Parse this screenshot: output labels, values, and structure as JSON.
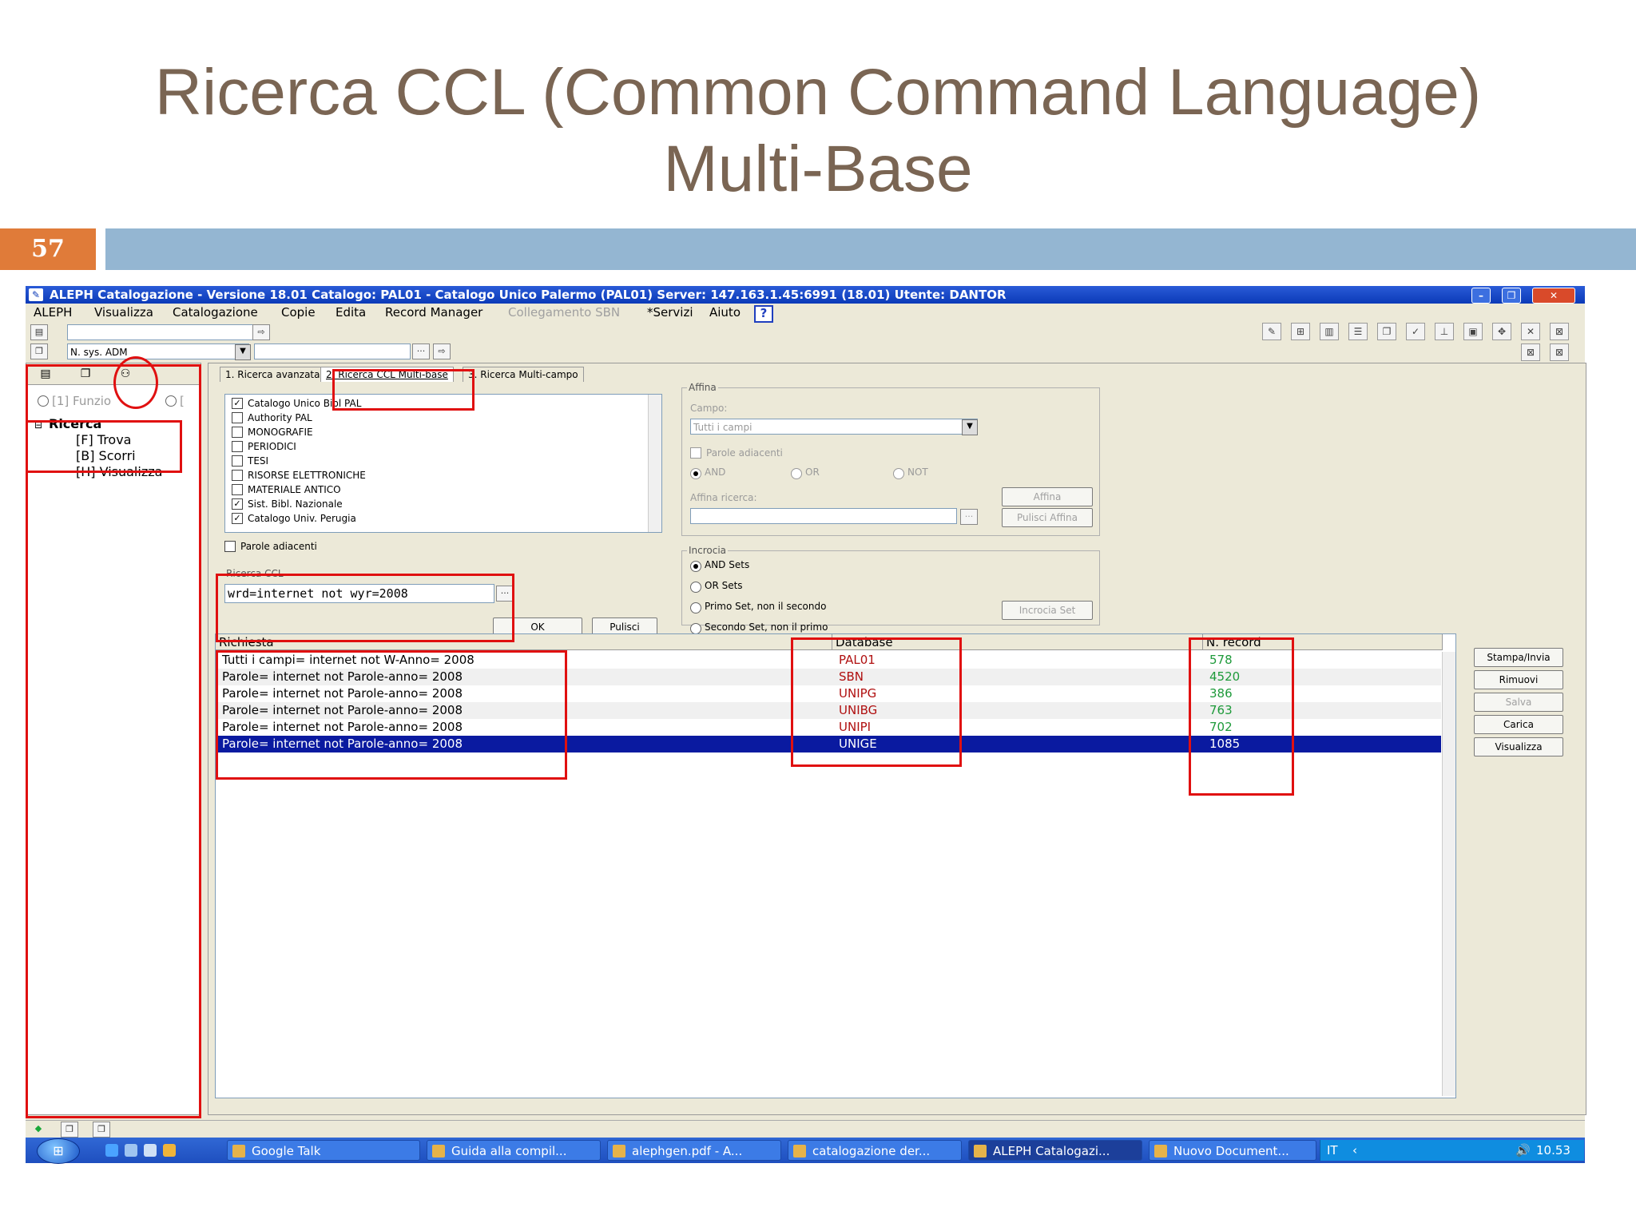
{
  "slide": {
    "title_line1": "Ricerca CCL (Common Command Language)",
    "title_line2": "Multi-Base",
    "number": "57",
    "colors": {
      "number_bg": "#e07b39",
      "bar": "#94b6d2",
      "title": "#7a6553"
    }
  },
  "window": {
    "title": "ALEPH Catalogazione - Versione 18.01  Catalogo:  PAL01 - Catalogo Unico Palermo (PAL01)  Server:  147.163.1.45:6991 (18.01)  Utente:  DANTOR",
    "controls": {
      "minimize": "–",
      "restore": "❐",
      "close": "✕"
    }
  },
  "menu": {
    "items": [
      "ALEPH",
      "Visualizza",
      "Catalogazione",
      "Copie",
      "Edita",
      "Record Manager",
      "Collegamento SBN",
      "*Servizi",
      "Aiuto"
    ],
    "help_icon": "?"
  },
  "toolbar": {
    "index_select": "N. sys. ADM",
    "browse_button": "···",
    "go_arrow": "⇨"
  },
  "left_panel": {
    "radio1": "[1] Funzio",
    "radio2": "[",
    "tree_root": "Ricerca",
    "tree_items": [
      "[F] Trova",
      "[B] Scorri",
      "[H] Visualizza"
    ],
    "tree_toggle": "⊟"
  },
  "tabs": [
    "1. Ricerca avanzata",
    "2. Ricerca CCL Multi-base",
    "3. Ricerca Multi-campo"
  ],
  "databases": [
    {
      "label": "Catalogo Unico Bibl PAL",
      "checked": true
    },
    {
      "label": "Authority PAL",
      "checked": false
    },
    {
      "label": "MONOGRAFIE",
      "checked": false
    },
    {
      "label": "PERIODICI",
      "checked": false
    },
    {
      "label": "TESI",
      "checked": false
    },
    {
      "label": "RISORSE ELETTRONICHE",
      "checked": false
    },
    {
      "label": "MATERIALE ANTICO",
      "checked": false
    },
    {
      "label": "Sist. Bibl. Nazionale",
      "checked": true
    },
    {
      "label": "Catalogo Univ. Perugia",
      "checked": true
    }
  ],
  "ccl": {
    "adjacent_label": "Parole adiacenti",
    "group_label": "Ricerca CCL",
    "query": "wrd=internet not wyr=2008",
    "browse": "···",
    "ok": "OK",
    "clear": "Pulisci"
  },
  "affina": {
    "group_label": "Affina",
    "campo_label": "Campo:",
    "campo_value": "Tutti i campi",
    "adjacent": "Parole adiacenti",
    "and": "AND",
    "or": "OR",
    "not": "NOT",
    "search_label": "Affina ricerca:",
    "browse": "···",
    "affina_btn": "Affina",
    "clear_btn": "Pulisci Affina"
  },
  "incrocia": {
    "group_label": "Incrocia",
    "options": [
      "AND Sets",
      "OR Sets",
      "Primo Set, non il secondo",
      "Secondo Set, non il primo"
    ],
    "button": "Incrocia Set"
  },
  "results": {
    "headers": {
      "query": "Richiesta",
      "database": "Database",
      "records": "N. record"
    },
    "rows": [
      {
        "query": "Tutti i campi= internet not W-Anno= 2008",
        "database": "PAL01",
        "records": "578"
      },
      {
        "query": "Parole= internet not Parole-anno= 2008",
        "database": "SBN",
        "records": "4520"
      },
      {
        "query": "Parole= internet not Parole-anno= 2008",
        "database": "UNIPG",
        "records": "386"
      },
      {
        "query": "Parole= internet not Parole-anno= 2008",
        "database": "UNIBG",
        "records": "763"
      },
      {
        "query": "Parole= internet not Parole-anno= 2008",
        "database": "UNIPI",
        "records": "702"
      },
      {
        "query": "Parole= internet not Parole-anno= 2008",
        "database": "UNIGE",
        "records": "1085"
      }
    ],
    "selected_index": 5
  },
  "actions": [
    "Stampa/Invia",
    "Rimuovi",
    "Salva",
    "Carica",
    "Visualizza"
  ],
  "taskbar": {
    "items": [
      "Google Talk",
      "Guida alla compil...",
      "alephgen.pdf - A...",
      "catalogazione der...",
      "ALEPH Catalogazi...",
      "Nuovo Document..."
    ],
    "language": "IT",
    "clock": "10.53"
  }
}
